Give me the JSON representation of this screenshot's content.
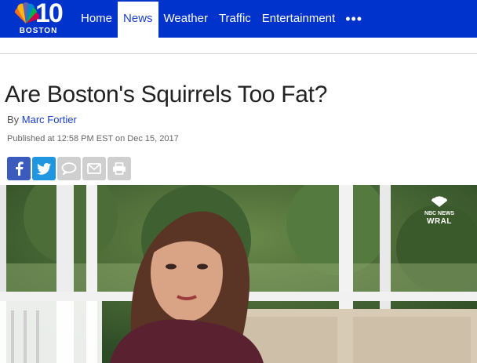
{
  "brand": {
    "number": "10",
    "city": "BOSTON"
  },
  "nav": {
    "items": [
      {
        "label": "Home",
        "active": false
      },
      {
        "label": "News",
        "active": true
      },
      {
        "label": "Weather",
        "active": false
      },
      {
        "label": "Traffic",
        "active": false
      },
      {
        "label": "Entertainment",
        "active": false
      }
    ],
    "more": "•••"
  },
  "article": {
    "title": "Are Boston's Squirrels Too Fat?",
    "byline_prefix": "By",
    "author": "Marc Fortier",
    "published": "Published at 12:58 PM EST on Dec 15, 2017"
  },
  "share": {
    "buttons": [
      {
        "icon": "facebook-icon",
        "color": "#3b5bbd"
      },
      {
        "icon": "twitter-icon",
        "color": "#2196e0"
      },
      {
        "icon": "comment-icon",
        "color": "#cfcfcf"
      },
      {
        "icon": "email-icon",
        "color": "#cfcfcf"
      },
      {
        "icon": "print-icon",
        "color": "#cfcfcf"
      }
    ]
  },
  "video": {
    "watermark_line1": "NBC NEWS",
    "watermark_line2": "WRAL"
  },
  "colors": {
    "nav_blue": "#0033cc",
    "link_blue": "#1a3fcc"
  }
}
